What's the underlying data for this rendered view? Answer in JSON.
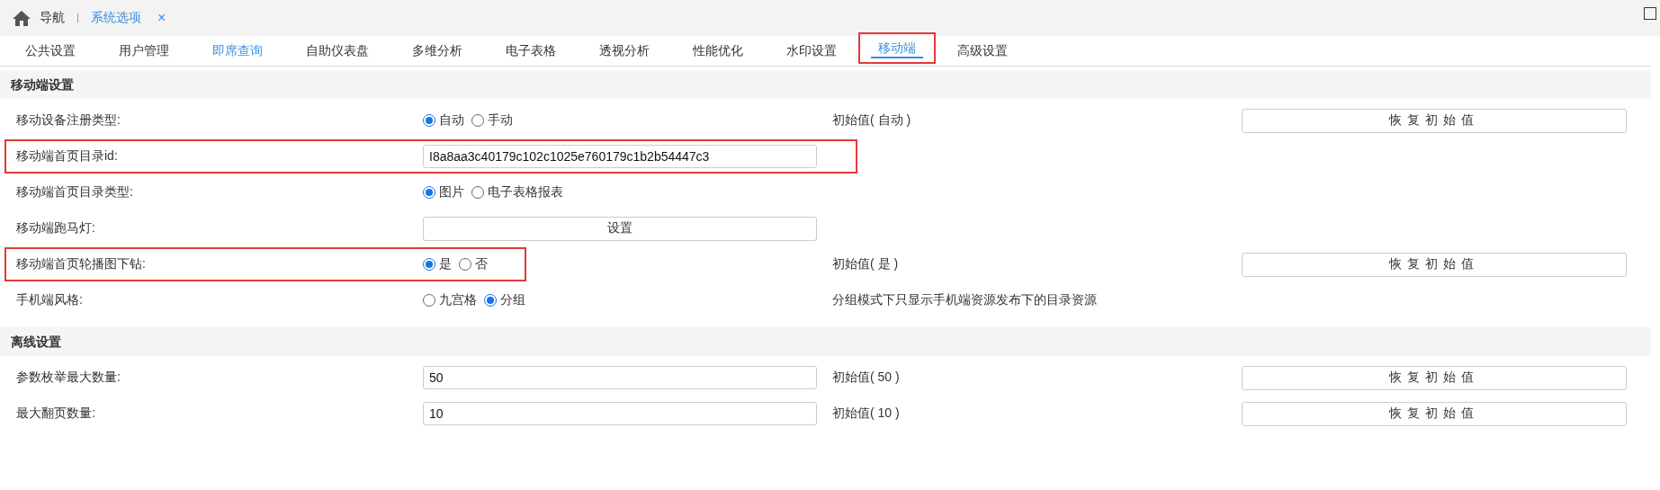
{
  "breadcrumb": {
    "home": "导航",
    "current": "系统选项",
    "close": "×"
  },
  "tabs": [
    {
      "label": "公共设置",
      "selected": false,
      "highlighted": false,
      "accent": false
    },
    {
      "label": "用户管理",
      "selected": false,
      "highlighted": false,
      "accent": false
    },
    {
      "label": "即席查询",
      "selected": false,
      "highlighted": false,
      "accent": true
    },
    {
      "label": "自助仪表盘",
      "selected": false,
      "highlighted": false,
      "accent": false
    },
    {
      "label": "多维分析",
      "selected": false,
      "highlighted": false,
      "accent": false
    },
    {
      "label": "电子表格",
      "selected": false,
      "highlighted": false,
      "accent": false
    },
    {
      "label": "透视分析",
      "selected": false,
      "highlighted": false,
      "accent": false
    },
    {
      "label": "性能优化",
      "selected": false,
      "highlighted": false,
      "accent": false
    },
    {
      "label": "水印设置",
      "selected": false,
      "highlighted": false,
      "accent": false
    },
    {
      "label": "移动端",
      "selected": true,
      "highlighted": true,
      "accent": false
    },
    {
      "label": "高级设置",
      "selected": false,
      "highlighted": false,
      "accent": false
    }
  ],
  "sections": [
    {
      "title": "移动端设置",
      "rows": [
        {
          "kind": "radio",
          "label": "移动设备注册类型:",
          "highlighted": false,
          "options": [
            {
              "label": "自动",
              "selected": true
            },
            {
              "label": "手动",
              "selected": false
            }
          ],
          "initial": "初始值( 自动 )",
          "reset": "恢复初始值"
        },
        {
          "kind": "input",
          "label": "移动端首页目录id:",
          "highlighted": true,
          "value": "I8a8aa3c40179c102c1025e760179c1b2b54447c3"
        },
        {
          "kind": "radio",
          "label": "移动端首页目录类型:",
          "highlighted": false,
          "options": [
            {
              "label": "图片",
              "selected": true
            },
            {
              "label": "电子表格报表",
              "selected": false
            }
          ]
        },
        {
          "kind": "button",
          "label": "移动端跑马灯:",
          "highlighted": false,
          "button": "设置"
        },
        {
          "kind": "radio",
          "label": "移动端首页轮播图下钻:",
          "highlighted": true,
          "options": [
            {
              "label": "是",
              "selected": true
            },
            {
              "label": "否",
              "selected": false
            }
          ],
          "initial": "初始值( 是 )",
          "reset": "恢复初始值"
        },
        {
          "kind": "radio",
          "label": "手机端风格:",
          "highlighted": false,
          "options": [
            {
              "label": "九宫格",
              "selected": false
            },
            {
              "label": "分组",
              "selected": true
            }
          ],
          "initial": "分组模式下只显示手机端资源发布下的目录资源"
        }
      ]
    },
    {
      "title": "离线设置",
      "rows": [
        {
          "kind": "input",
          "label": "参数枚举最大数量:",
          "highlighted": false,
          "value": "50",
          "initial": "初始值( 50 )",
          "reset": "恢复初始值"
        },
        {
          "kind": "input",
          "label": "最大翻页数量:",
          "highlighted": false,
          "value": "10",
          "initial": "初始值( 10 )",
          "reset": "恢复初始值"
        }
      ]
    }
  ]
}
